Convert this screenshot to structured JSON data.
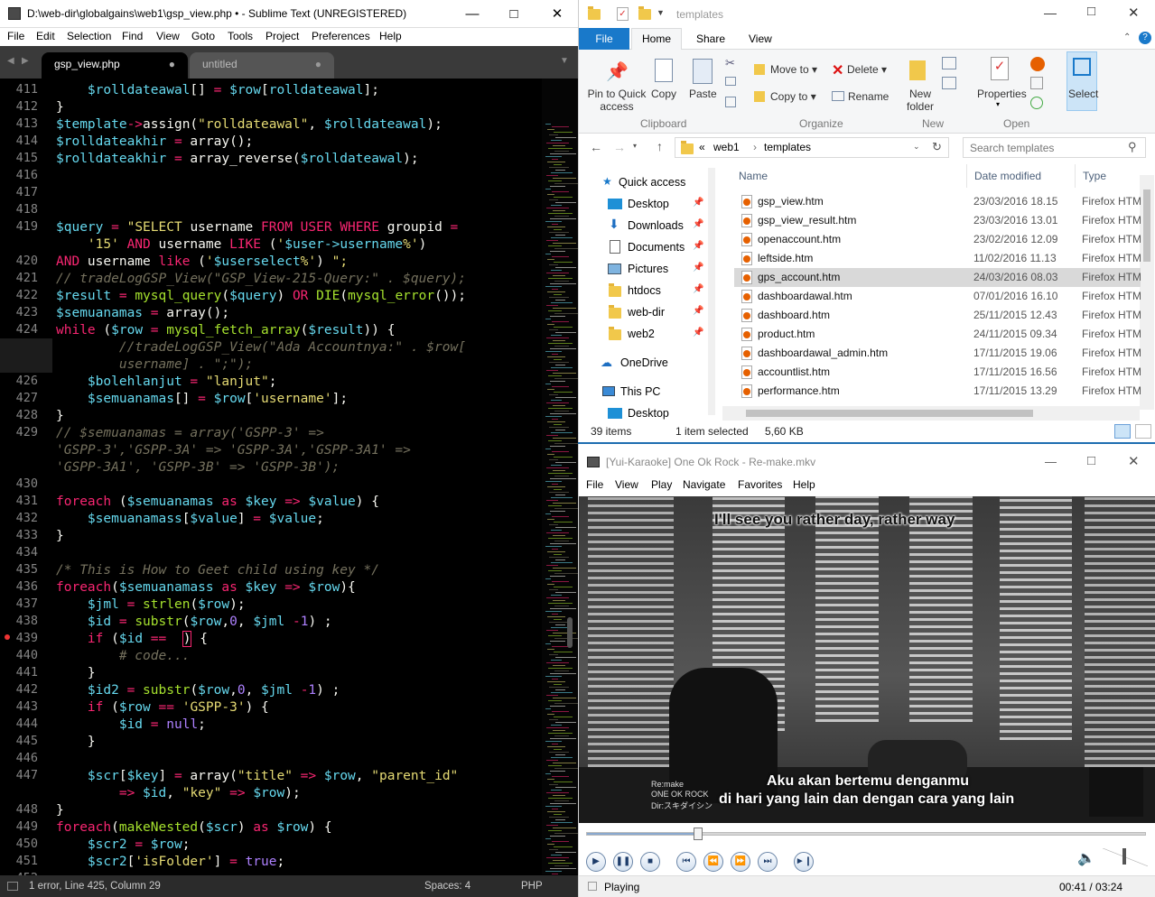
{
  "sublime": {
    "title": "D:\\web-dir\\globalgains\\web1\\gsp_view.php • - Sublime Text (UNREGISTERED)",
    "menu": [
      "File",
      "Edit",
      "Selection",
      "Find",
      "View",
      "Goto",
      "Tools",
      "Project",
      "Preferences",
      "Help"
    ],
    "tabs": [
      {
        "label": "gsp_view.php",
        "dirty": "●"
      },
      {
        "label": "untitled",
        "dirty": "●"
      }
    ],
    "line_numbers": [
      "411",
      "412",
      "413",
      "414",
      "415",
      "416",
      "417",
      "418",
      "419",
      "",
      "420",
      "421",
      "422",
      "423",
      "424",
      "425",
      "",
      "426",
      "427",
      "428",
      "429",
      "",
      "",
      "430",
      "431",
      "432",
      "433",
      "434",
      "435",
      "436",
      "437",
      "438",
      "439",
      "440",
      "441",
      "442",
      "443",
      "444",
      "445",
      "446",
      "447",
      "",
      "448",
      "449",
      "450",
      "451",
      "452"
    ],
    "status": {
      "left": "1 error, Line 425, Column 29",
      "spaces": "Spaces: 4",
      "syntax": "PHP"
    },
    "colors": {
      "variable": "#66d9ef",
      "keyword": "#f92672",
      "string": "#e6db74",
      "function": "#a6e22e",
      "comment": "#75715e",
      "background": "#000000"
    }
  },
  "explorer": {
    "title": "templates",
    "tabs": [
      "File",
      "Home",
      "Share",
      "View"
    ],
    "ribbon": {
      "pin": "Pin to Quick access",
      "copy": "Copy",
      "paste": "Paste",
      "move_to": "Move to",
      "copy_to": "Copy to",
      "delete": "Delete",
      "rename": "Rename",
      "new_folder": "New folder",
      "properties": "Properties",
      "select": "Select",
      "groups": [
        "Clipboard",
        "Organize",
        "New",
        "Open"
      ]
    },
    "breadcrumb": [
      "«",
      "web1",
      "templates"
    ],
    "search_placeholder": "Search templates",
    "nav": [
      "Quick access",
      "Desktop",
      "Downloads",
      "Documents",
      "Pictures",
      "htdocs",
      "web-dir",
      "web2",
      "OneDrive",
      "This PC",
      "Desktop"
    ],
    "columns": [
      "Name",
      "Date modified",
      "Type"
    ],
    "files": [
      {
        "name": "gsp_view.htm",
        "date": "23/03/2016 18.15",
        "type": "Firefox HTM"
      },
      {
        "name": "gsp_view_result.htm",
        "date": "23/03/2016 13.01",
        "type": "Firefox HTM"
      },
      {
        "name": "openaccount.htm",
        "date": "23/02/2016 12.09",
        "type": "Firefox HTM"
      },
      {
        "name": "leftside.htm",
        "date": "11/02/2016 11.13",
        "type": "Firefox HTM"
      },
      {
        "name": "gps_account.htm",
        "date": "24/03/2016 08.03",
        "type": "Firefox HTM"
      },
      {
        "name": "dashboardawal.htm",
        "date": "07/01/2016 16.10",
        "type": "Firefox HTM"
      },
      {
        "name": "dashboard.htm",
        "date": "25/11/2015 12.43",
        "type": "Firefox HTM"
      },
      {
        "name": "product.htm",
        "date": "24/11/2015 09.34",
        "type": "Firefox HTM"
      },
      {
        "name": "dashboardawal_admin.htm",
        "date": "17/11/2015 19.06",
        "type": "Firefox HTM"
      },
      {
        "name": "accountlist.htm",
        "date": "17/11/2015 16.56",
        "type": "Firefox HTM"
      },
      {
        "name": "performance.htm",
        "date": "17/11/2015 13.29",
        "type": "Firefox HTM"
      }
    ],
    "status": {
      "count": "39 items",
      "selected": "1 item selected",
      "size": "5,60 KB"
    }
  },
  "player": {
    "title": "[Yui-Karaoke] One Ok Rock - Re-make.mkv",
    "menu": [
      "File",
      "View",
      "Play",
      "Navigate",
      "Favorites",
      "Help"
    ],
    "subtitle_top": "I'll see you rather day, rather way",
    "subtitle_line1": "Aku akan bertemu denganmu",
    "subtitle_line2": "di hari yang lain dan dengan cara yang lain",
    "credit": [
      "Re:make",
      "ONE OK ROCK",
      "Dir:スキダイシン"
    ],
    "status": "Playing",
    "time": "00:41 / 03:24",
    "progress": 0.2
  }
}
